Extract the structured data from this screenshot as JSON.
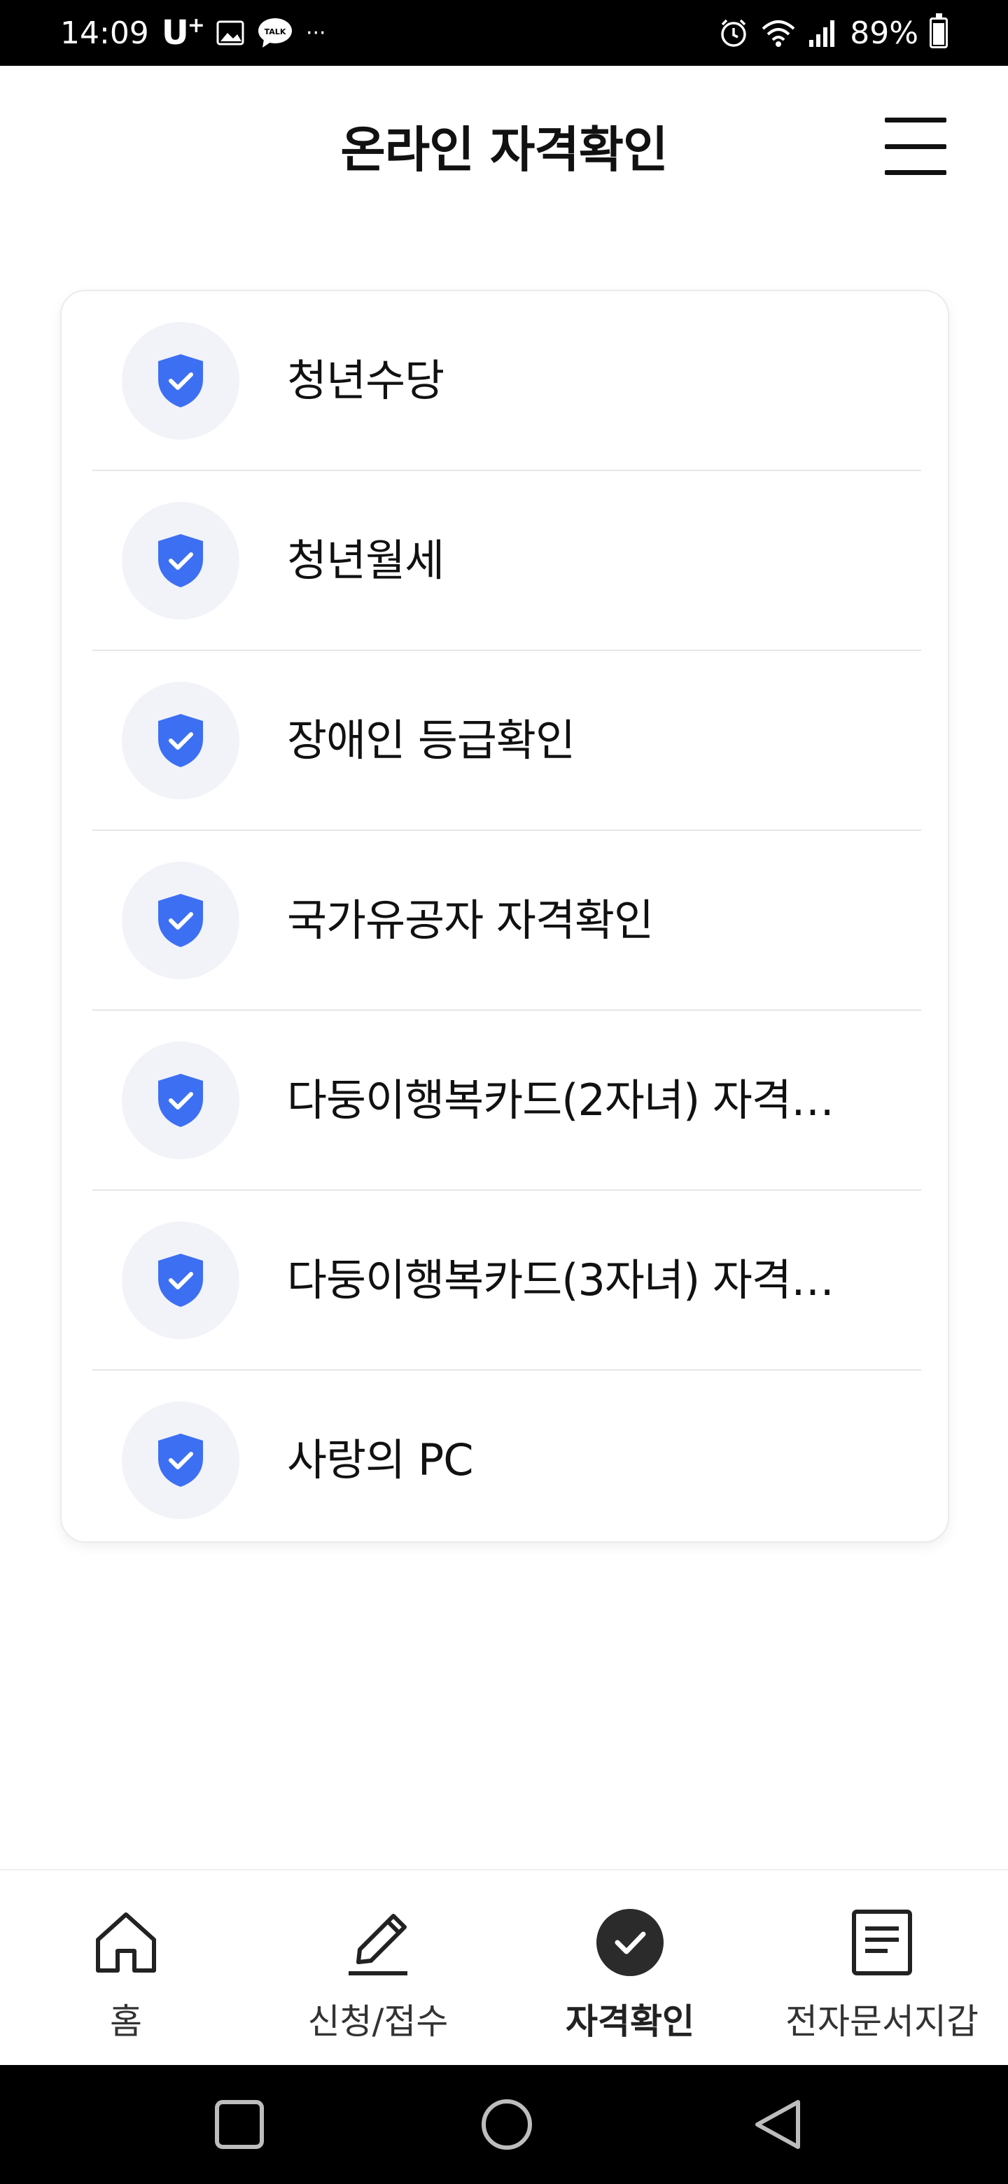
{
  "status_bar": {
    "time": "14:09",
    "carrier": "U",
    "carrier_super": "+",
    "more": "···",
    "battery": "89%"
  },
  "header": {
    "title": "온라인 자격확인"
  },
  "list": {
    "items": [
      {
        "label": "청년수당"
      },
      {
        "label": "청년월세"
      },
      {
        "label": "장애인 등급확인"
      },
      {
        "label": "국가유공자 자격확인"
      },
      {
        "label": "다둥이행복카드(2자녀) 자격…"
      },
      {
        "label": "다둥이행복카드(3자녀) 자격…"
      },
      {
        "label": "사랑의 PC"
      }
    ]
  },
  "bottom_nav": {
    "items": [
      {
        "label": "홈"
      },
      {
        "label": "신청/접수"
      },
      {
        "label": "자격확인"
      },
      {
        "label": "전자문서지갑"
      }
    ],
    "active": "자격확인"
  },
  "colors": {
    "accent": "#3d6ff2",
    "icon_bg": "#f1f3f8",
    "active_nav_circle": "#2b2b2b"
  }
}
